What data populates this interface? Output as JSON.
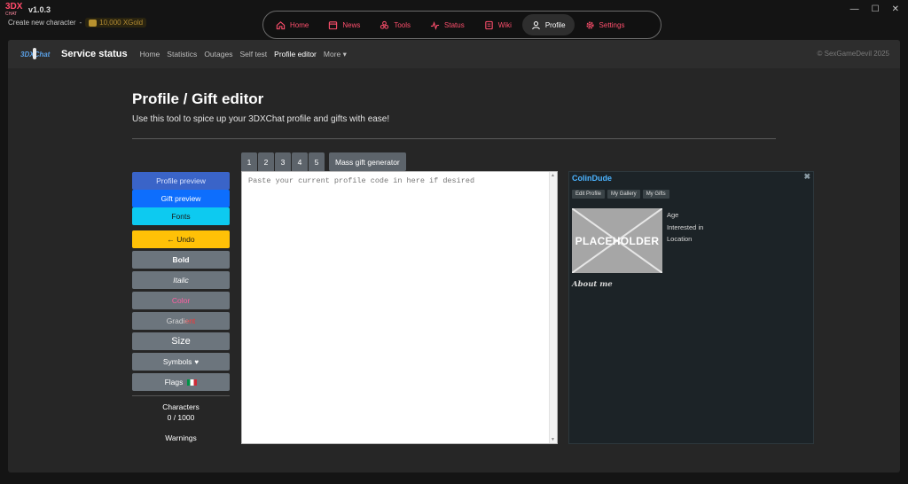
{
  "app": {
    "badge_top": "3DX",
    "badge_bottom": "CHAT",
    "version": "v1.0.3",
    "create_label": "Create new character",
    "separator": "-",
    "gold": "10,000 XGold"
  },
  "window": {
    "minimize": "—",
    "maximize": "☐",
    "close": "✕"
  },
  "topnav": {
    "items": [
      {
        "label": "Home",
        "icon": "home-icon"
      },
      {
        "label": "News",
        "icon": "news-icon"
      },
      {
        "label": "Tools",
        "icon": "tools-icon"
      },
      {
        "label": "Status",
        "icon": "status-icon"
      },
      {
        "label": "Wiki",
        "icon": "wiki-icon"
      },
      {
        "label": "Profile",
        "icon": "user-icon",
        "active": true
      },
      {
        "label": "Settings",
        "icon": "gear-icon"
      }
    ]
  },
  "subnav": {
    "logo": "3DXChat",
    "title": "Service status",
    "links": [
      "Home",
      "Statistics",
      "Outages",
      "Self test",
      "Profile editor"
    ],
    "active": "Profile editor",
    "more": "More ▾",
    "copyright": "© SexGameDevil 2025"
  },
  "page": {
    "title": "Profile / Gift editor",
    "subtitle": "Use this tool to spice up your 3DXChat profile and gifts with ease!"
  },
  "leftcol": {
    "profile_preview": "Profile preview",
    "gift_preview": "Gift preview",
    "fonts": "Fonts",
    "undo": "← Undo",
    "bold": "Bold",
    "italic": "Italic",
    "color": "Color",
    "gradient": "Gradient",
    "size": "Size",
    "symbols": "Symbols",
    "symbols_heart": "♥",
    "flags": "Flags",
    "characters_label": "Characters",
    "characters_count": "0 / 1000",
    "warnings_label": "Warnings"
  },
  "tabs": [
    "1",
    "2",
    "3",
    "4",
    "5"
  ],
  "mass_gift": "Mass gift generator",
  "editor": {
    "placeholder": "Paste your current profile code in here if desired",
    "value": ""
  },
  "preview": {
    "username": "ColinDude",
    "close": "✖",
    "buttons": [
      "Edit Profile",
      "My Gallery",
      "My Gifts"
    ],
    "placeholder": "PLACEHOLDER",
    "meta": [
      "Age",
      "Interested in",
      "Location"
    ],
    "about": "About me"
  },
  "colors": {
    "accent_red": "#ff4f6d",
    "primary_blue": "#0d6efd",
    "info_cyan": "#0dcaf0",
    "warning_yellow": "#ffc107",
    "secondary_gray": "#6c757d",
    "username_blue": "#4bb3ff"
  }
}
